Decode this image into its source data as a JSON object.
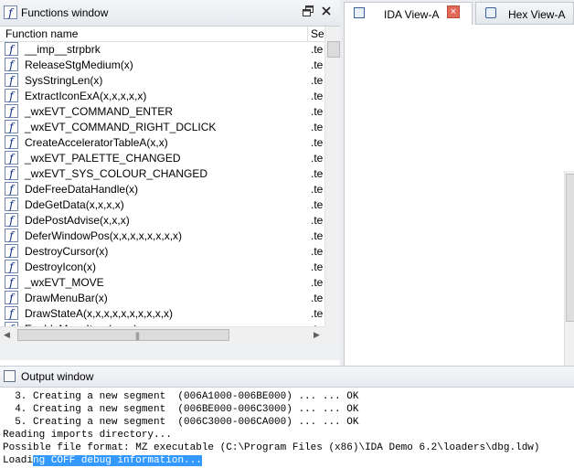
{
  "functions_window": {
    "title": "Functions window",
    "float_icon": "float-window-icon",
    "close_icon": "close-icon",
    "columns": [
      "Function name",
      "Se"
    ],
    "rows": [
      {
        "name": "__imp__strpbrk",
        "segment": ".te"
      },
      {
        "name": "ReleaseStgMedium(x)",
        "segment": ".te"
      },
      {
        "name": "SysStringLen(x)",
        "segment": ".te"
      },
      {
        "name": "ExtractIconExA(x,x,x,x,x)",
        "segment": ".te"
      },
      {
        "name": "_wxEVT_COMMAND_ENTER",
        "segment": ".te"
      },
      {
        "name": "_wxEVT_COMMAND_RIGHT_DCLICK",
        "segment": ".te"
      },
      {
        "name": "CreateAcceleratorTableA(x,x)",
        "segment": ".te"
      },
      {
        "name": "_wxEVT_PALETTE_CHANGED",
        "segment": ".te"
      },
      {
        "name": "_wxEVT_SYS_COLOUR_CHANGED",
        "segment": ".te"
      },
      {
        "name": "DdeFreeDataHandle(x)",
        "segment": ".te"
      },
      {
        "name": "DdeGetData(x,x,x,x)",
        "segment": ".te"
      },
      {
        "name": "DdePostAdvise(x,x,x)",
        "segment": ".te"
      },
      {
        "name": "DeferWindowPos(x,x,x,x,x,x,x,x)",
        "segment": ".te"
      },
      {
        "name": "DestroyCursor(x)",
        "segment": ".te"
      },
      {
        "name": "DestroyIcon(x)",
        "segment": ".te"
      },
      {
        "name": "_wxEVT_MOVE",
        "segment": ".te"
      },
      {
        "name": "DrawMenuBar(x)",
        "segment": ".te"
      },
      {
        "name": "DrawStateA(x,x,x,x,x,x,x,x,x,x)",
        "segment": ".te"
      },
      {
        "name": "EnableMenuItem(x,x,x)",
        "segment": ".te"
      }
    ],
    "function_icon_glyph": "f"
  },
  "tabs": [
    {
      "label": "IDA View-A",
      "icon": "disassembly-view-icon",
      "active": true,
      "close_icon": "close-tab-icon"
    },
    {
      "label": "Hex View-A",
      "icon": "hex-view-icon",
      "active": false
    }
  ],
  "output_window": {
    "title": "Output window",
    "icon": "output-window-icon",
    "lines": [
      "  3. Creating a new segment  (006A1000-006BE000) ... ... OK",
      "  4. Creating a new segment  (006BE000-006C3000) ... ... OK",
      "  5. Creating a new segment  (006C3000-006CA000) ... ... OK",
      "Reading imports directory...",
      "Possible file format: MZ executable (C:\\Program Files (x86)\\IDA Demo 6.2\\loaders\\dbg.ldw)"
    ],
    "last_line_start": "Loadi",
    "last_line_selected": "ng COFF debug information..."
  },
  "colors": {
    "selection": "#3399ff",
    "tab_close": "#e26a5a",
    "function_icon": "#0a2a80"
  }
}
